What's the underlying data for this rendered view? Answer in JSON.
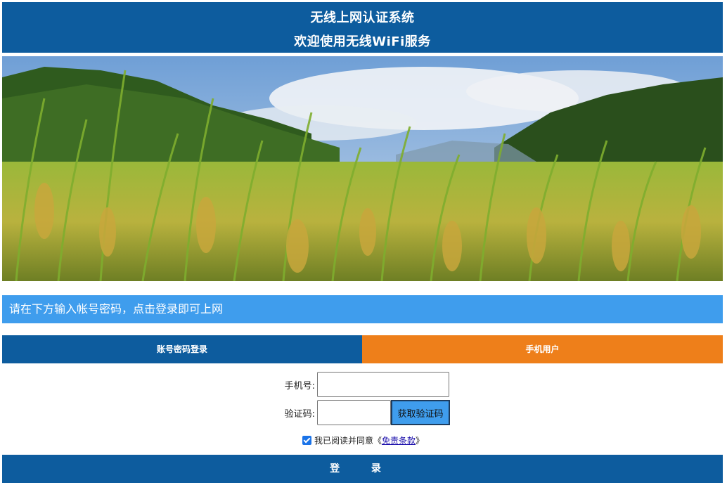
{
  "header": {
    "title": "无线上网认证系统",
    "subtitle": "欢迎使用无线WiFi服务"
  },
  "notice": {
    "text": "请在下方输入帐号密码，点击登录即可上网"
  },
  "tabs": [
    {
      "label": "账号密码登录",
      "color": "#0d5c9e"
    },
    {
      "label": "手机用户",
      "color": "#ee7f1a"
    }
  ],
  "form": {
    "phone_label": "手机号:",
    "phone_value": "",
    "code_label": "验证码:",
    "code_value": "",
    "get_code_button": "获取验证码",
    "agree_checked": true,
    "agree_prefix": "我已阅读并同意《",
    "agree_link": "免责条款",
    "agree_suffix": "》"
  },
  "login_button": "登 录",
  "colors": {
    "primary": "#0d5c9e",
    "accent": "#ee7f1a",
    "info": "#3f9ded"
  }
}
